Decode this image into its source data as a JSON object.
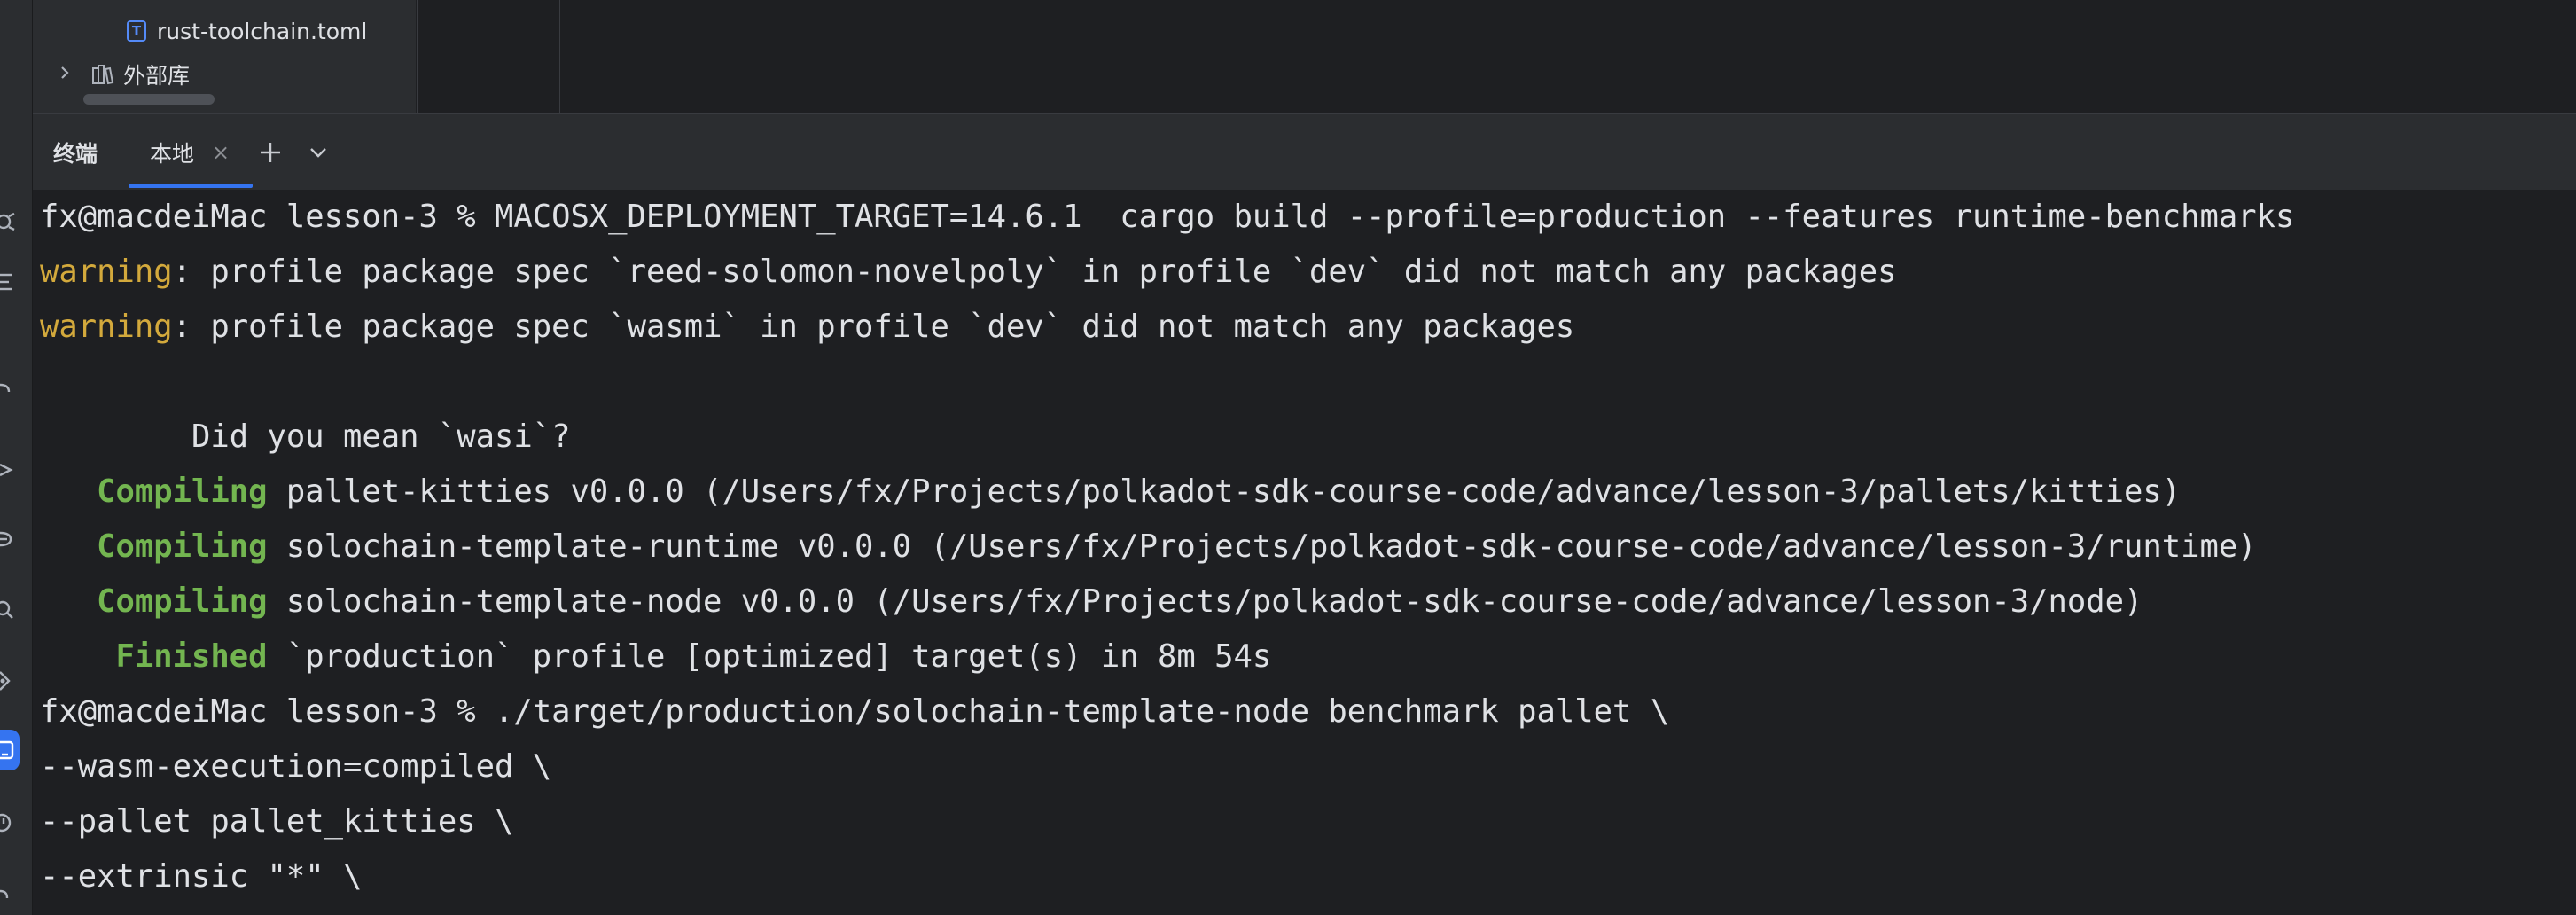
{
  "project_tree": {
    "items": [
      {
        "label": "rust-toolchain.toml",
        "icon": "toml-file-icon",
        "icon_letter": "T"
      },
      {
        "label": "外部库",
        "icon": "library-icon",
        "expander": "chevron-right-icon"
      }
    ]
  },
  "terminal": {
    "panel_title": "终端",
    "tabs": [
      {
        "label": "本地",
        "close": "×"
      }
    ],
    "add_tab": "+",
    "lines": [
      {
        "segments": [
          {
            "text": "fx@macdeiMac lesson-3 % MACOSX_DEPLOYMENT_TARGET=14.6.1  cargo build --profile=production --features runtime-benchmarks",
            "style": "plain"
          }
        ]
      },
      {
        "segments": [
          {
            "text": "warning",
            "style": "warn"
          },
          {
            "text": ": profile package spec `reed-solomon-novelpoly` in profile `dev` did not match any packages",
            "style": "plain"
          }
        ]
      },
      {
        "segments": [
          {
            "text": "warning",
            "style": "warn"
          },
          {
            "text": ": profile package spec `wasmi` in profile `dev` did not match any packages",
            "style": "plain"
          }
        ]
      },
      {
        "segments": [
          {
            "text": "",
            "style": "plain"
          }
        ]
      },
      {
        "segments": [
          {
            "text": "        Did you mean `wasi`?",
            "style": "plain"
          }
        ]
      },
      {
        "segments": [
          {
            "text": "   Compiling",
            "style": "green"
          },
          {
            "text": " pallet-kitties v0.0.0 (/Users/fx/Projects/polkadot-sdk-course-code/advance/lesson-3/pallets/kitties)",
            "style": "plain"
          }
        ]
      },
      {
        "segments": [
          {
            "text": "   Compiling",
            "style": "green"
          },
          {
            "text": " solochain-template-runtime v0.0.0 (/Users/fx/Projects/polkadot-sdk-course-code/advance/lesson-3/runtime)",
            "style": "plain"
          }
        ]
      },
      {
        "segments": [
          {
            "text": "   Compiling",
            "style": "green"
          },
          {
            "text": " solochain-template-node v0.0.0 (/Users/fx/Projects/polkadot-sdk-course-code/advance/lesson-3/node)",
            "style": "plain"
          }
        ]
      },
      {
        "segments": [
          {
            "text": "    Finished",
            "style": "green"
          },
          {
            "text": " `production` profile [optimized] target(s) in 8m 54s",
            "style": "plain"
          }
        ]
      },
      {
        "segments": [
          {
            "text": "fx@macdeiMac lesson-3 % ./target/production/solochain-template-node benchmark pallet \\",
            "style": "plain"
          }
        ]
      },
      {
        "segments": [
          {
            "text": "--wasm-execution=compiled \\",
            "style": "plain"
          }
        ]
      },
      {
        "segments": [
          {
            "text": "--pallet pallet_kitties \\",
            "style": "plain"
          }
        ]
      },
      {
        "segments": [
          {
            "text": "--extrinsic \"*\" \\",
            "style": "plain"
          }
        ]
      }
    ]
  },
  "colors": {
    "background": "#1e1f22",
    "panel": "#2b2d30",
    "accent": "#3574f0",
    "warning": "#d3a93c",
    "success": "#73b550",
    "text": "#dfe1e5"
  }
}
